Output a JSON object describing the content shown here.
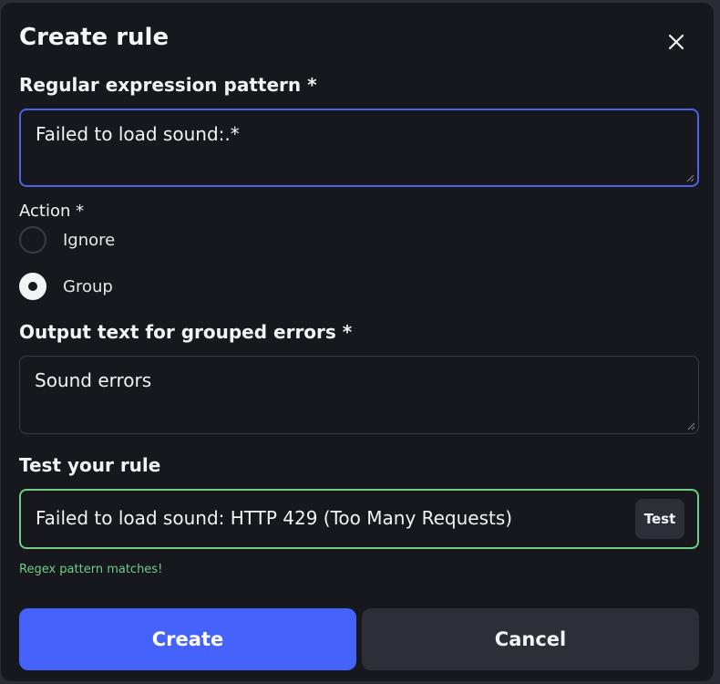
{
  "dialog": {
    "title": "Create rule",
    "close_icon": "close-icon"
  },
  "pattern": {
    "label": "Regular expression pattern *",
    "value": "Failed to load sound:.*"
  },
  "action": {
    "label": "Action *",
    "options": [
      {
        "label": "Ignore",
        "checked": false
      },
      {
        "label": "Group",
        "checked": true
      }
    ]
  },
  "output": {
    "label": "Output text for grouped errors *",
    "value": "Sound errors"
  },
  "test": {
    "label": "Test your rule",
    "value": "Failed to load sound: HTTP 429 (Too Many Requests)",
    "button_label": "Test",
    "result_message": "Regex pattern matches!"
  },
  "footer": {
    "create_label": "Create",
    "cancel_label": "Cancel"
  },
  "colors": {
    "accent": "#4563fb",
    "focus_border": "#4a63e8",
    "success": "#6fcf87",
    "background": "#17181d"
  }
}
